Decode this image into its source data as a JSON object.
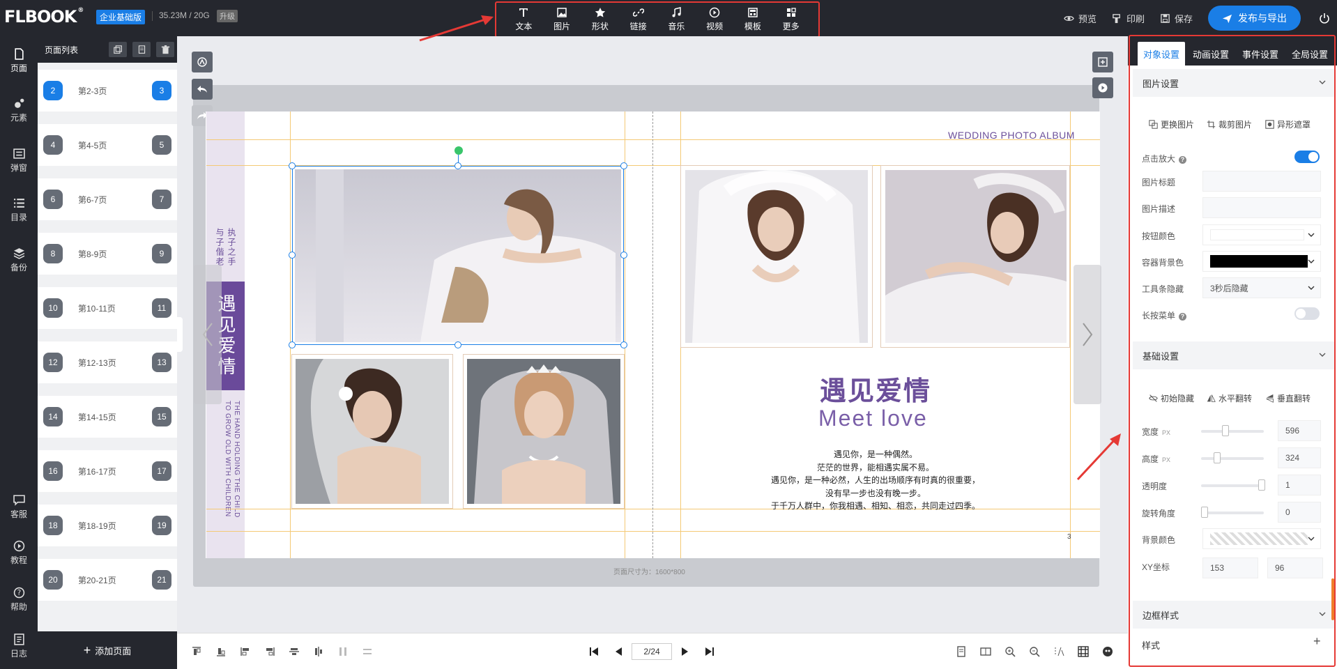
{
  "app": {
    "logo": "FLBOOK",
    "logo_mark": "®",
    "edition": "企业基础版",
    "storage": "35.23M / 20G",
    "upgrade": "升级"
  },
  "toolbar": {
    "items": [
      {
        "label": "文本",
        "icon": "text-icon"
      },
      {
        "label": "图片",
        "icon": "image-icon"
      },
      {
        "label": "形状",
        "icon": "star-icon"
      },
      {
        "label": "链接",
        "icon": "link-icon"
      },
      {
        "label": "音乐",
        "icon": "music-icon"
      },
      {
        "label": "视频",
        "icon": "video-icon"
      },
      {
        "label": "模板",
        "icon": "template-icon"
      },
      {
        "label": "更多",
        "icon": "more-icon"
      }
    ],
    "preview": "预览",
    "print": "印刷",
    "save": "保存",
    "publish": "发布与导出"
  },
  "leftnav": {
    "items": [
      {
        "label": "页面",
        "icon": "page-icon"
      },
      {
        "label": "元素",
        "icon": "elements-icon"
      },
      {
        "label": "弹窗",
        "icon": "popup-icon"
      },
      {
        "label": "目录",
        "icon": "toc-icon"
      },
      {
        "label": "备份",
        "icon": "backup-icon"
      },
      {
        "label": "客服",
        "icon": "chat-icon"
      },
      {
        "label": "教程",
        "icon": "play-icon"
      },
      {
        "label": "帮助",
        "icon": "help-icon"
      },
      {
        "label": "日志",
        "icon": "log-icon"
      }
    ]
  },
  "pagepanel": {
    "title": "页面列表",
    "add_page": "添加页面",
    "pages": [
      {
        "left": "2",
        "label": "第2-3页",
        "right": "3",
        "active": true
      },
      {
        "left": "4",
        "label": "第4-5页",
        "right": "5"
      },
      {
        "left": "6",
        "label": "第6-7页",
        "right": "7"
      },
      {
        "left": "8",
        "label": "第8-9页",
        "right": "9"
      },
      {
        "left": "10",
        "label": "第10-11页",
        "right": "11"
      },
      {
        "left": "12",
        "label": "第12-13页",
        "right": "13"
      },
      {
        "left": "14",
        "label": "第14-15页",
        "right": "15"
      },
      {
        "left": "16",
        "label": "第16-17页",
        "right": "17"
      },
      {
        "left": "18",
        "label": "第18-19页",
        "right": "19"
      },
      {
        "left": "20",
        "label": "第20-21页",
        "right": "21"
      }
    ]
  },
  "canvas": {
    "page_size": "页面尺寸为：1600*800",
    "left_page": {
      "vertical_cn_1": "执子之手",
      "vertical_cn_2": "与子偕老",
      "title_block": "遇见爱情",
      "vertical_en_1": "THE HAND HOLDING THE CHILD",
      "vertical_en_2": "TO GROW OLD WITH CHILDREN"
    },
    "right_page": {
      "header": "WEDDING PHOTO ALBUM",
      "title_cn": "遇见爱情",
      "title_en": "Meet love",
      "poem": [
        "遇见你，是一种偶然。",
        "茫茫的世界，能相遇实属不易。",
        "遇见你，是一种必然，人生的出场顺序有时真的很重要，",
        "没有早一步也没有晚一步。",
        "于千万人群中，你我相遇、相知、相恋，共同走过四季。"
      ],
      "page_number": "3"
    }
  },
  "bottom": {
    "page_indicator": "2/24"
  },
  "rpanel": {
    "tabs": [
      "对象设置",
      "动画设置",
      "事件设置",
      "全局设置"
    ],
    "image_section": "图片设置",
    "image_actions": [
      "更换图片",
      "裁剪图片",
      "异形遮罩"
    ],
    "click_zoom": "点击放大",
    "image_title": "图片标题",
    "image_desc": "图片描述",
    "button_color": "按钮颜色",
    "container_bg": "容器背景色",
    "toolbar_hide": "工具条隐藏",
    "toolbar_hide_value": "3秒后隐藏",
    "longpress_menu": "长按菜单",
    "basic_section": "基础设置",
    "basic_actions": [
      "初始隐藏",
      "水平翻转",
      "垂直翻转"
    ],
    "width_label": "宽度",
    "height_label": "高度",
    "px_unit": "PX",
    "width_value": "596",
    "height_value": "324",
    "opacity_label": "透明度",
    "opacity_value": "1",
    "rotation_label": "旋转角度",
    "rotation_value": "0",
    "bg_color_label": "背景颜色",
    "xy_label": "XY坐标",
    "x_value": "153",
    "y_value": "96",
    "border_section": "边框样式",
    "style_label": "样式",
    "help_glyph": "?",
    "colors": {
      "accent": "#1a7ee6",
      "purple": "#6a4a9a",
      "highlight": "#e53935"
    }
  }
}
